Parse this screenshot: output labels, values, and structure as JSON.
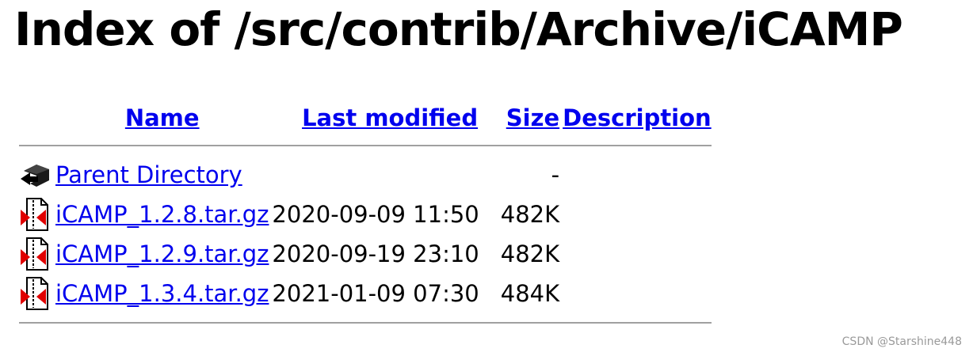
{
  "page": {
    "heading": "Index of /src/contrib/Archive/iCAMP"
  },
  "columns": {
    "name": "Name",
    "last_modified": "Last modified",
    "size": "Size",
    "description": "Description"
  },
  "parent": {
    "label": "Parent Directory",
    "last_modified": "",
    "size": "-",
    "icon": "back-arrow-icon"
  },
  "files": [
    {
      "name": "iCAMP_1.2.8.tar.gz",
      "last_modified": "2020-09-09 11:50",
      "size": "482K",
      "description": "",
      "icon": "compressed-file-icon"
    },
    {
      "name": "iCAMP_1.2.9.tar.gz",
      "last_modified": "2020-09-19 23:10",
      "size": "482K",
      "description": "",
      "icon": "compressed-file-icon"
    },
    {
      "name": "iCAMP_1.3.4.tar.gz",
      "last_modified": "2021-01-09 07:30",
      "size": "484K",
      "description": "",
      "icon": "compressed-file-icon"
    }
  ],
  "colors": {
    "link": "#0000ee",
    "rule": "#a0a0a0",
    "watermark": "#9a9a9a"
  },
  "watermark": "CSDN @Starshine448"
}
